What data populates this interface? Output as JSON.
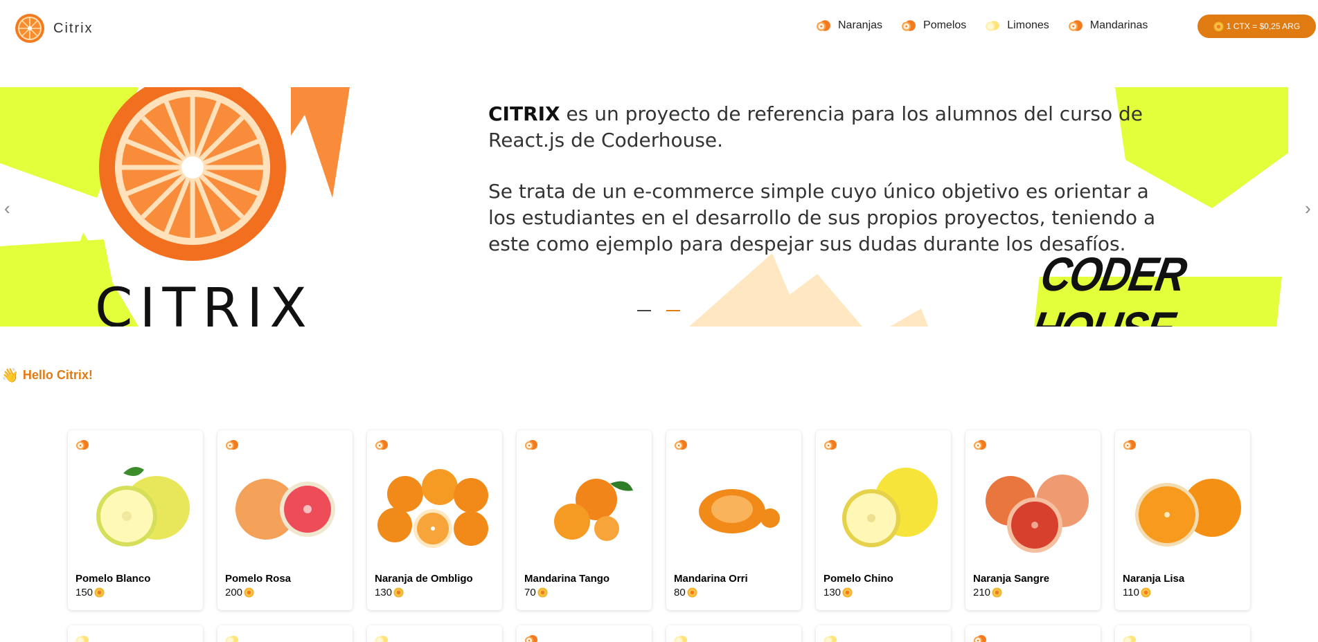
{
  "app": {
    "name": "Citrix"
  },
  "nav": [
    {
      "label": "Naranjas",
      "icon": "orange-icon"
    },
    {
      "label": "Pomelos",
      "icon": "grapefruit-icon"
    },
    {
      "label": "Limones",
      "icon": "lemon-icon"
    },
    {
      "label": "Mandarinas",
      "icon": "tangerine-icon"
    }
  ],
  "rate": {
    "label": "1 CTX = $0,25 ARG"
  },
  "hero": {
    "brand": "CITRIX",
    "paragraph1_rest": " es un proyecto de referencia para los alumnos del curso de React.js de Coderhouse.",
    "paragraph2": "Se trata de un e-commerce simple cuyo único objetivo es orientar a los estudiantes en el desarrollo de sus propios proyectos, teniendo a este como ejemplo para despejar sus dudas durante los desafíos.",
    "logo_word": "CITRIX",
    "partner": "CODER HOUSE",
    "prev_arrow": "‹",
    "next_arrow": "›"
  },
  "greeting": {
    "text": "Hello Citrix!",
    "icon": "waving-hand-icon"
  },
  "colors": {
    "accent": "#e07b12",
    "lime": "#e3ff3b",
    "orange": "#f47a20"
  },
  "products": [
    {
      "name": "Pomelo Blanco",
      "price": "150",
      "kind": "pomelo-blanco"
    },
    {
      "name": "Pomelo Rosa",
      "price": "200",
      "kind": "pomelo-rosa"
    },
    {
      "name": "Naranja de Ombligo",
      "price": "130",
      "kind": "naranja-ombligo"
    },
    {
      "name": "Mandarina Tango",
      "price": "70",
      "kind": "mandarina-tango"
    },
    {
      "name": "Mandarina Orri",
      "price": "80",
      "kind": "mandarina-orri"
    },
    {
      "name": "Pomelo Chino",
      "price": "130",
      "kind": "pomelo-chino"
    },
    {
      "name": "Naranja Sangre",
      "price": "210",
      "kind": "naranja-sangre"
    },
    {
      "name": "Naranja Lisa",
      "price": "110",
      "kind": "naranja-lisa"
    }
  ]
}
